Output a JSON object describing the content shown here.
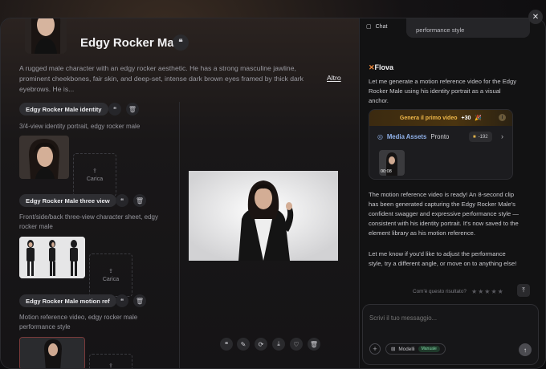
{
  "element": {
    "title": "Edgy Rocker Male",
    "description": "A rugged male character with an edgy rocker aesthetic. He has a strong masculine jawline, prominent cheekbones, fair skin, and deep-set, intense dark brown eyes framed by thick dark eyebrows. He is...",
    "more_link": "Altro",
    "quote_icon": "quote-icon"
  },
  "sections": [
    {
      "label": "Edgy Rocker Male identity",
      "description": "3/4-view identity portrait, edgy rocker male",
      "upload_label": "Carica"
    },
    {
      "label": "Edgy Rocker Male three view",
      "description": "Front/side/back three-view character sheet, edgy rocker male",
      "upload_label": "Carica"
    },
    {
      "label": "Edgy Rocker Male motion ref",
      "description": "Motion reference video, edgy rocker male performance style",
      "upload_label": "Carica"
    }
  ],
  "toolbar": {
    "icons": [
      "quote-icon",
      "edit-icon",
      "regenerate-icon",
      "download-icon",
      "favorite-icon",
      "delete-icon"
    ]
  },
  "chat": {
    "header_label": "Chat",
    "previous_bubble_text": "performance style",
    "brand": "Flova",
    "brand_mark": "F",
    "intro": "Let me generate a motion reference video for the Edgy Rocker Male using his identity portrait as a visual anchor.",
    "card": {
      "banner_text": "Genera il primo video",
      "banner_bonus": "+30",
      "assets_label": "Media Assets",
      "assets_status": "Pronto",
      "credits": "-192",
      "video_time": "00:08"
    },
    "message_1": "The motion reference video is ready! An 8-second clip has been generated capturing the Edgy Rocker Male's confident swagger and expressive performance style — consistent with his identity portrait. It's now saved to the element library as his motion reference.",
    "message_2": "Let me know if you'd like to adjust the performance style, try a different angle, or move on to anything else!",
    "rating_prompt": "Com'è questo risultato?",
    "stars": "★★★★★",
    "input_placeholder": "Scrivi il tuo messaggio...",
    "models_label": "Modelli",
    "manual_badge": "Manuale"
  },
  "colors": {
    "accent_orange": "#f08a3c",
    "banner_gold": "#f1b94a",
    "assets_blue": "#8fb0e8"
  }
}
